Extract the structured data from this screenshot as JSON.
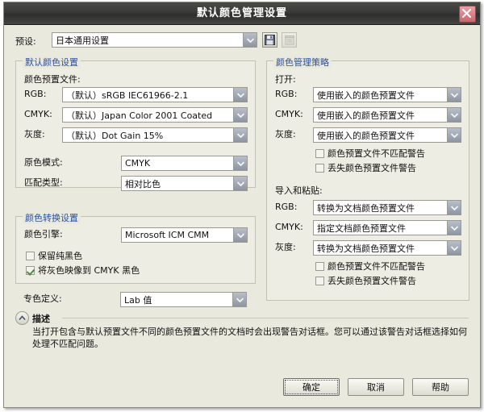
{
  "window": {
    "title": "默认颜色管理设置",
    "close_icon": "close-x-icon"
  },
  "preset": {
    "label": "预设:",
    "value": "日本通用设置",
    "save_icon": "save-floppy-icon",
    "delete_icon": "trash-delete-icon"
  },
  "default_color_settings": {
    "group_title": "默认颜色设置",
    "subhead": "颜色预置文件:",
    "rows": [
      {
        "label": "RGB:",
        "value": "（默认）sRGB IEC61966-2.1"
      },
      {
        "label": "CMYK:",
        "value": "（默认）Japan Color 2001 Coated"
      },
      {
        "label": "灰度:",
        "value": "（默认）Dot Gain 15%"
      }
    ],
    "primary_mode": {
      "label": "原色模式:",
      "value": "CMYK"
    },
    "match_type": {
      "label": "匹配类型:",
      "value": "相对比色"
    }
  },
  "color_conversion": {
    "group_title": "颜色转换设置",
    "engine": {
      "label": "颜色引擎:",
      "value": "Microsoft ICM CMM"
    },
    "checkboxes": [
      {
        "label": "保留纯黑色",
        "checked": false
      },
      {
        "label": "将灰色映像到 CMYK 黑色",
        "checked": true
      }
    ]
  },
  "spot_color": {
    "label": "专色定义:",
    "value": "Lab 值"
  },
  "color_policy": {
    "group_title": "颜色管理策略",
    "open_subhead": "打开:",
    "open_rows": [
      {
        "label": "RGB:",
        "value": "使用嵌入的颜色预置文件"
      },
      {
        "label": "CMYK:",
        "value": "使用嵌入的颜色预置文件"
      },
      {
        "label": "灰度:",
        "value": "使用嵌入的颜色预置文件"
      }
    ],
    "open_checkboxes": [
      {
        "label": "颜色预置文件不匹配警告",
        "checked": false
      },
      {
        "label": "丢失颜色预置文件警告",
        "checked": false
      }
    ],
    "paste_subhead": "导入和粘贴:",
    "paste_rows": [
      {
        "label": "RGB:",
        "value": "转换为文档颜色预置文件"
      },
      {
        "label": "CMYK:",
        "value": "指定文档颜色预置文件"
      },
      {
        "label": "灰度:",
        "value": "转换为文档颜色预置文件"
      }
    ],
    "paste_checkboxes": [
      {
        "label": "颜色预置文件不匹配警告",
        "checked": false
      },
      {
        "label": "丢失颜色预置文件警告",
        "checked": false
      }
    ]
  },
  "description": {
    "icon": "collapse-chevron-up-icon",
    "title": "描述",
    "body": "当打开包含与默认预置文件不同的颜色预置文件的文档时会出现警告对话框。您可以通过该警告对话框选择如何处理不匹配问题。"
  },
  "footer": {
    "ok": "确定",
    "cancel": "取消",
    "help": "帮助"
  }
}
